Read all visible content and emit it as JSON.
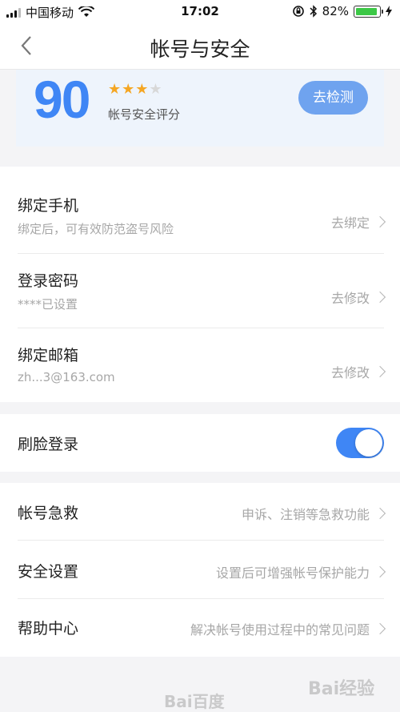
{
  "status_bar": {
    "carrier": "中国移动",
    "time": "17:02",
    "battery": "82%"
  },
  "header": {
    "title": "帐号与安全"
  },
  "score": {
    "value": "90",
    "label": "帐号安全评分",
    "stars_filled": 3,
    "stars_total": 4,
    "check_button": "去检测"
  },
  "binding": [
    {
      "title": "绑定手机",
      "subtitle": "绑定后，可有效防范盗号风险",
      "action": "去绑定"
    },
    {
      "title": "登录密码",
      "subtitle": "****已设置",
      "action": "去修改"
    },
    {
      "title": "绑定邮箱",
      "subtitle": "zh...3@163.com",
      "action": "去修改"
    }
  ],
  "face_login": {
    "title": "刷脸登录",
    "enabled": true
  },
  "more": [
    {
      "title": "帐号急救",
      "desc": "申诉、注销等急救功能"
    },
    {
      "title": "安全设置",
      "desc": "设置后可增强帐号保护能力"
    },
    {
      "title": "帮助中心",
      "desc": "解决帐号使用过程中的常见问题"
    }
  ],
  "watermarks": {
    "center": "Bai百度",
    "corner": "Bai经验"
  },
  "colors": {
    "accent": "#3f86f5",
    "star": "#f5a623",
    "button": "#6fa3ef"
  }
}
